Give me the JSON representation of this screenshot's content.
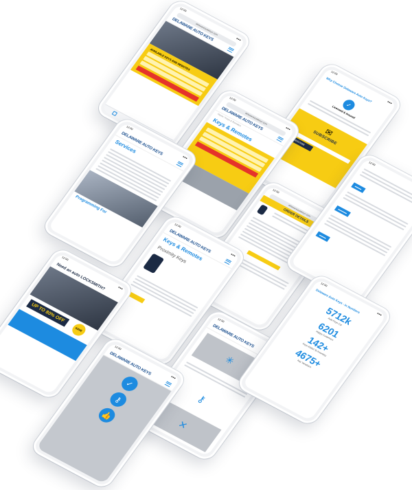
{
  "brand": {
    "logo": "DELAWARE AUTO KEYS",
    "accent": "#1d8be0",
    "yellow": "#f7cc13",
    "red": "#e5332a"
  },
  "phones": {
    "p1": {
      "cta": "AVAILABLE KEYS AND REMOTES"
    },
    "p2": {
      "heading": "Why Choose Delaware Auto Keys?",
      "feature": "Licensed & Insured",
      "subscribe": "SUBSCRIBE",
      "button": "SUBSCRIBE"
    },
    "p3": {
      "title": "Keys & Remotes",
      "crumb": "Home / Keys & Remotes"
    },
    "p4": {
      "title": "Services",
      "sub": "Programming For"
    },
    "p5": {
      "header": "ORDER DETAILS"
    },
    "p7": {
      "title": "Keys & Remotes",
      "sub": "Proximity Keys"
    },
    "p8": {
      "headline": "Need an auto LOCKSMITH?",
      "sale": "UP TO 80% OFF",
      "save": "SAVE"
    },
    "p10": {
      "heading": "Delaware Auto Keys - In Numbers",
      "stats": [
        {
          "num": "5712k",
          "label": "Auto Keys Cut"
        },
        {
          "num": "6201",
          "label": "Happy Customers"
        },
        {
          "num": "142+",
          "label": "Keys Added To Inventory"
        },
        {
          "num": "4675+",
          "label": "Key Variations"
        }
      ]
    }
  }
}
